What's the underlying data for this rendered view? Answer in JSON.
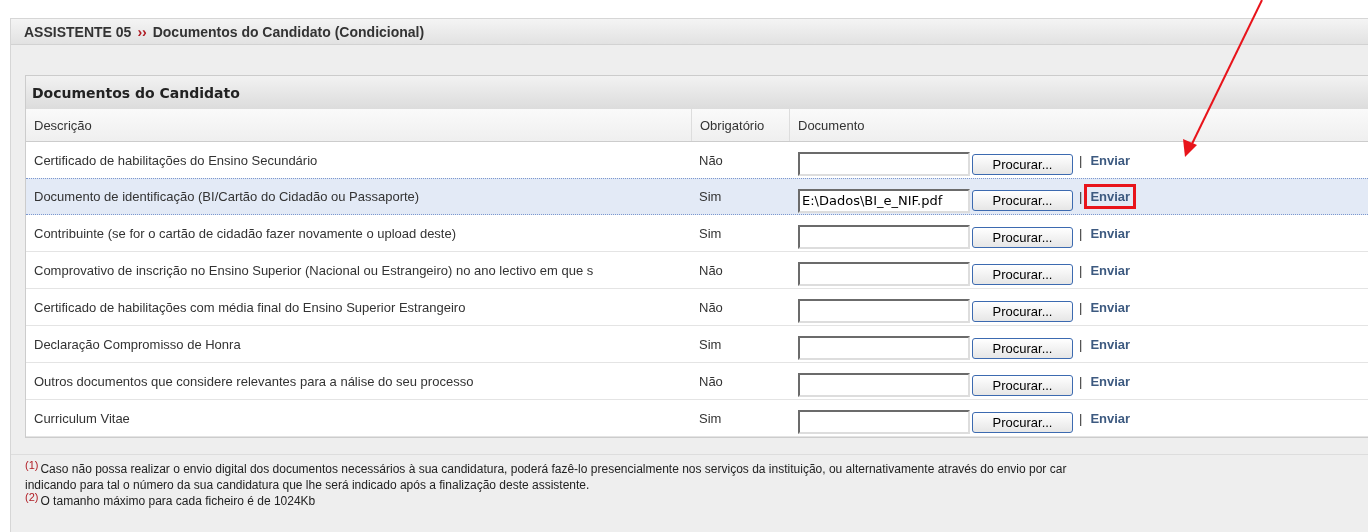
{
  "header": {
    "step": "ASSISTENTE 05",
    "separator": "››",
    "title": "Documentos do Candidato (Condicional)"
  },
  "panel": {
    "title": "Documentos do Candidato",
    "columns": [
      "Descrição",
      "Obrigatório",
      "Documento"
    ],
    "rows": [
      {
        "description": "Certificado de habilitações do Ensino Secundário",
        "required": "Não",
        "file": "",
        "browse": "Procurar...",
        "separator": "|",
        "send": "Enviar",
        "selected": false,
        "marked": false
      },
      {
        "description": "Documento de identificação (BI/Cartão do Cidadão ou Passaporte)",
        "required": "Sim",
        "file": "E:\\Dados\\BI_e_NIF.pdf",
        "browse": "Procurar...",
        "separator": "|",
        "send": "Enviar",
        "selected": true,
        "marked": true
      },
      {
        "description": "Contribuinte (se for o cartão de cidadão fazer novamente o upload deste)",
        "required": "Sim",
        "file": "",
        "browse": "Procurar...",
        "separator": "|",
        "send": "Enviar",
        "selected": false,
        "marked": false
      },
      {
        "description": "Comprovativo de inscrição no Ensino Superior (Nacional ou Estrangeiro) no ano lectivo em que s",
        "required": "Não",
        "file": "",
        "browse": "Procurar...",
        "separator": "|",
        "send": "Enviar",
        "selected": false,
        "marked": false
      },
      {
        "description": "Certificado de habilitações com média final do Ensino Superior Estrangeiro",
        "required": "Não",
        "file": "",
        "browse": "Procurar...",
        "separator": "|",
        "send": "Enviar",
        "selected": false,
        "marked": false
      },
      {
        "description": "Declaração Compromisso de Honra",
        "required": "Sim",
        "file": "",
        "browse": "Procurar...",
        "separator": "|",
        "send": "Enviar",
        "selected": false,
        "marked": false
      },
      {
        "description": "Outros documentos que considere relevantes para a nálise do seu processo",
        "required": "Não",
        "file": "",
        "browse": "Procurar...",
        "separator": "|",
        "send": "Enviar",
        "selected": false,
        "marked": false
      },
      {
        "description": "Curriculum Vitae",
        "required": "Sim",
        "file": "",
        "browse": "Procurar...",
        "separator": "|",
        "send": "Enviar",
        "selected": false,
        "marked": false
      }
    ]
  },
  "footnotes": [
    {
      "mark": "(1)",
      "lines": [
        "Caso não possa realizar o envio digital dos documentos necessários à sua candidatura, poderá fazê-lo presencialmente nos serviços da instituição, ou alternativamente através do envio por car",
        "indicando para tal o número da sua candidatura que lhe será indicado após a finalização deste assistente."
      ]
    },
    {
      "mark": "(2)",
      "lines": [
        "O tamanho máximo para cada ficheiro é de 1024Kb"
      ]
    }
  ]
}
